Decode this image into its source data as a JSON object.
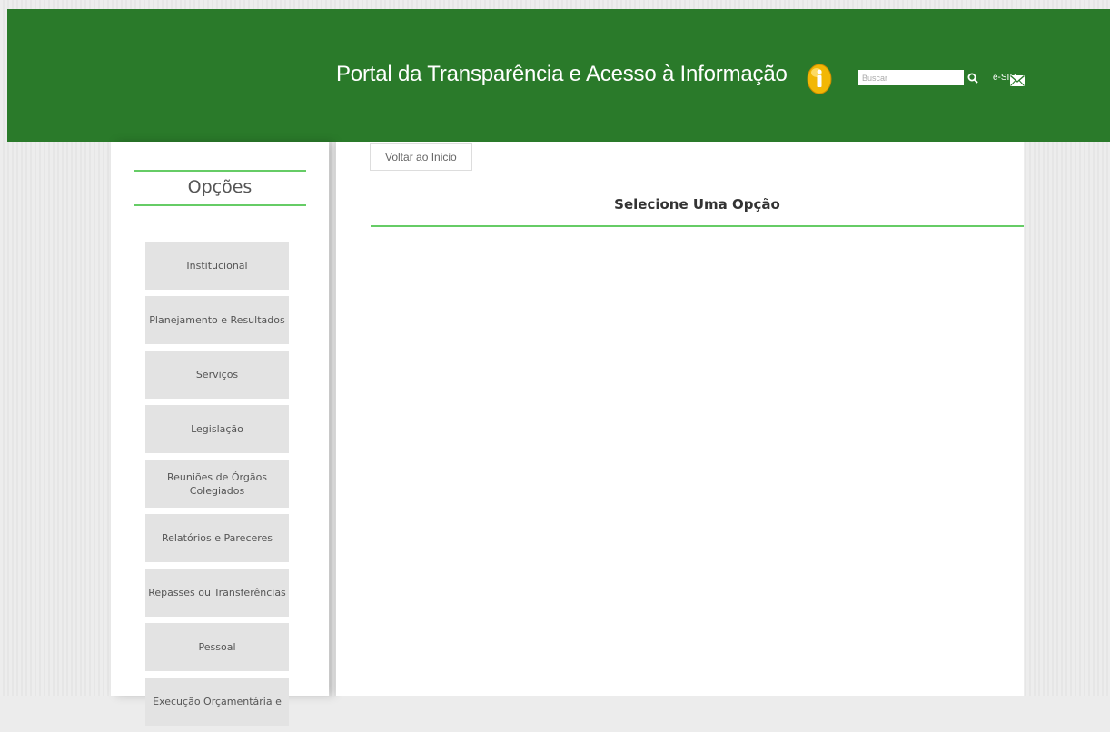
{
  "header": {
    "title": "Portal da Transparência e Acesso à Informação",
    "search_placeholder": "Buscar",
    "esic_label": "e-SIC",
    "background_color": "#2a7a2a"
  },
  "sidebar": {
    "title": "Opções",
    "items": [
      {
        "label": "Institucional"
      },
      {
        "label": "Planejamento e Resultados"
      },
      {
        "label": "Serviços"
      },
      {
        "label": "Legislação"
      },
      {
        "label": "Reuniões de Órgãos Colegiados"
      },
      {
        "label": "Relatórios e Pareceres"
      },
      {
        "label": "Repasses ou Transferências"
      },
      {
        "label": "Pessoal"
      },
      {
        "label": "Execução Orçamentária e"
      }
    ]
  },
  "main": {
    "back_button_label": "Voltar ao Inicio",
    "section_heading": "Selecione Uma Opção"
  },
  "colors": {
    "accent": "#66cc66",
    "menu_item_bg": "#e3e3e3",
    "page_bg": "#ececec"
  },
  "icons": {
    "info": "info-icon",
    "search": "search-icon",
    "mail": "mail-icon"
  }
}
